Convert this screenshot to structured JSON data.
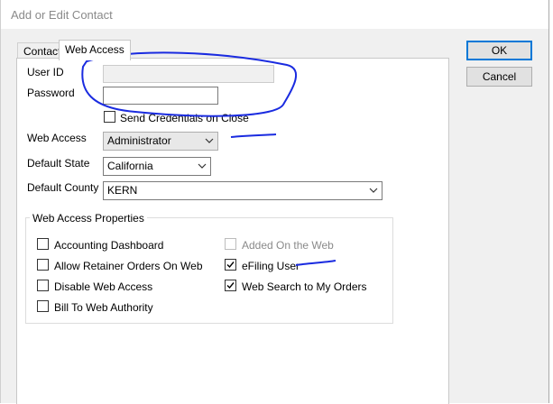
{
  "window": {
    "title": "Add or Edit Contact"
  },
  "tabs": [
    {
      "label": "Contact",
      "active": false
    },
    {
      "label": "Web Access",
      "active": true
    }
  ],
  "buttons": {
    "ok": "OK",
    "cancel": "Cancel"
  },
  "form": {
    "user_id_label": "User ID",
    "user_id_value": "",
    "password_label": "Password",
    "password_value": "",
    "send_credentials_label": "Send Credentials on Close",
    "send_credentials_checked": false,
    "web_access_label": "Web Access",
    "web_access_value": "Administrator",
    "default_state_label": "Default State",
    "default_state_value": "California",
    "default_county_label": "Default County",
    "default_county_value": "KERN"
  },
  "properties": {
    "title": "Web Access Properties",
    "items": [
      {
        "label": "Accounting Dashboard",
        "checked": false,
        "enabled": true
      },
      {
        "label": "Allow Retainer Orders On Web",
        "checked": false,
        "enabled": true
      },
      {
        "label": "Disable Web Access",
        "checked": false,
        "enabled": true
      },
      {
        "label": "Bill To Web Authority",
        "checked": false,
        "enabled": true
      },
      {
        "label": "Added On the Web",
        "checked": false,
        "enabled": false
      },
      {
        "label": "eFiling User",
        "checked": true,
        "enabled": true
      },
      {
        "label": "Web Search to My Orders",
        "checked": true,
        "enabled": true
      }
    ]
  },
  "colors": {
    "annotation": "#1a2be0",
    "focus": "#0078d7",
    "disabled_text": "#8a8a8a"
  }
}
